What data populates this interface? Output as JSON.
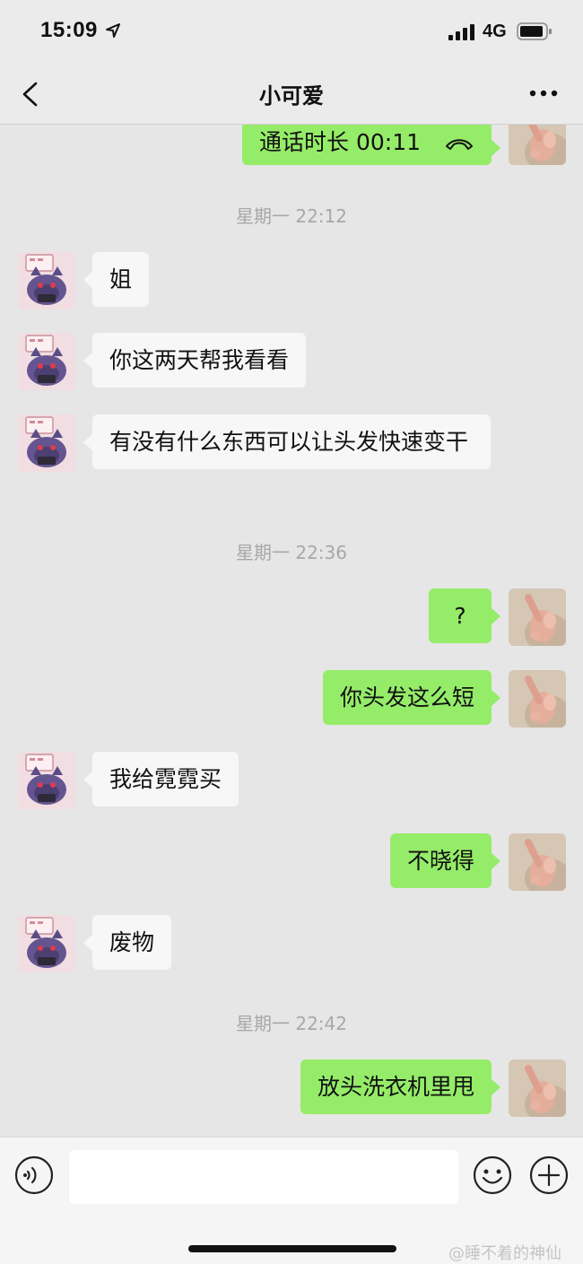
{
  "status_bar": {
    "time": "15:09",
    "network": "4G"
  },
  "nav": {
    "title": "小可爱"
  },
  "timestamps": [
    "星期一 22:12",
    "星期一 22:36",
    "星期一 22:42"
  ],
  "messages": [
    {
      "side": "out",
      "text": "通话时长 00:11"
    },
    {
      "side": "in",
      "text": "姐"
    },
    {
      "side": "in",
      "text": "你这两天帮我看看"
    },
    {
      "side": "in",
      "text": "有没有什么东西可以让头发快速变干"
    },
    {
      "side": "out",
      "text": "?"
    },
    {
      "side": "out",
      "text": "你头发这么短"
    },
    {
      "side": "in",
      "text": "我给霓霓买"
    },
    {
      "side": "out",
      "text": "不晓得"
    },
    {
      "side": "in",
      "text": "废物"
    },
    {
      "side": "out",
      "text": "放头洗衣机里甩"
    }
  ],
  "input_bar": {
    "placeholder": ""
  },
  "watermark": "@睡不着的神仙",
  "colors": {
    "bubble_out": "#95ec69",
    "bubble_in": "#f7f7f7",
    "background": "#e6e6e6"
  },
  "icons": [
    "location-arrow-icon",
    "signal-icon",
    "battery-icon",
    "back-icon",
    "more-icon",
    "phone-hangup-icon",
    "voice-icon",
    "emoji-icon",
    "plus-icon"
  ]
}
